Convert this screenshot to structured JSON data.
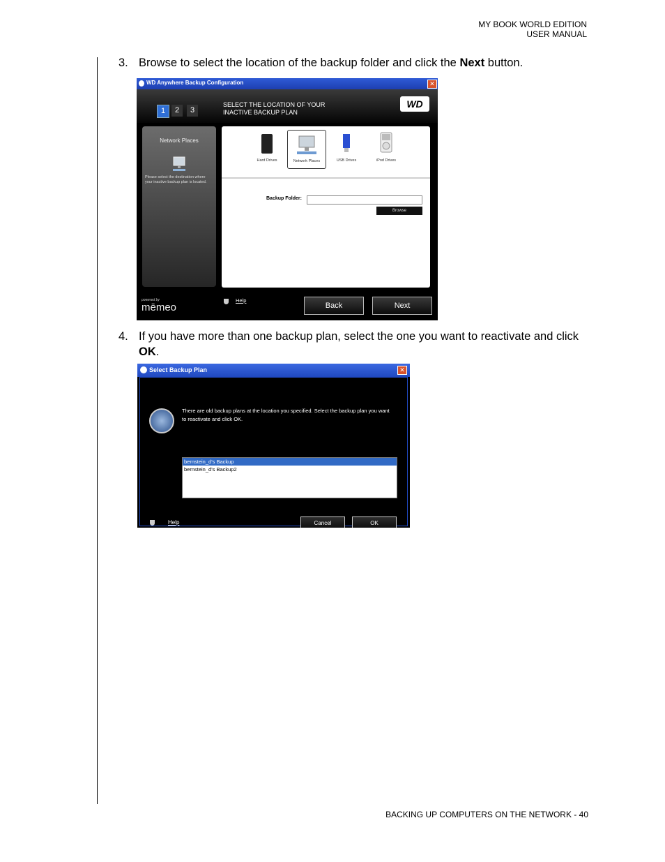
{
  "header": {
    "line1": "MY BOOK WORLD EDITION",
    "line2": "USER MANUAL"
  },
  "steps": [
    {
      "num": "3.",
      "pre": "Browse to select the location of the backup folder and click the ",
      "bold": "Next",
      "post": " button."
    },
    {
      "num": "4.",
      "pre": "If you have more than one backup plan, select the one you want to reactivate and click ",
      "bold": "OK",
      "post": "."
    }
  ],
  "window1": {
    "title": "WD Anywhere Backup Configuration",
    "steps": [
      "1",
      "2",
      "3"
    ],
    "heading_line1": "SELECT THE LOCATION OF YOUR",
    "heading_line2": "INACTIVE BACKUP PLAN",
    "logo": "WD",
    "left_title": "Network Places",
    "left_desc": "Please select the destination where your inactive backup plan is located.",
    "devices": [
      "Hard Drives",
      "Network Places",
      "USB Drives",
      "iPod Drives"
    ],
    "backup_folder_label": "Backup Folder:",
    "backup_folder_value": "",
    "browse_label": "Browse",
    "powered_by": "powered by",
    "brand": "mēmeo",
    "help": "Help",
    "back": "Back",
    "next": "Next"
  },
  "window2": {
    "title": "Select Backup Plan",
    "message": "There are old backup plans at the location you specified.  Select the backup plan you want to reactivate and click OK.",
    "plans": [
      "bernstein_d's Backup",
      "bernstein_d's Backup2"
    ],
    "help": "Help",
    "cancel": "Cancel",
    "ok": "OK"
  },
  "footer": "BACKING UP COMPUTERS ON THE NETWORK - 40"
}
